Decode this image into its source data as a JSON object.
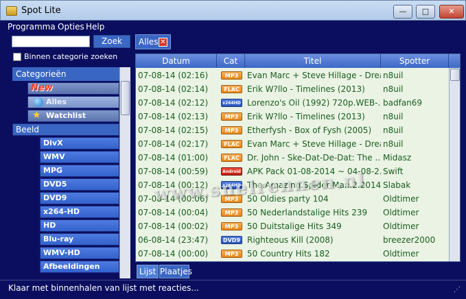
{
  "window": {
    "title": "Spot Lite",
    "min_glyph": "—",
    "max_glyph": "□",
    "close_glyph": "✕"
  },
  "menu": [
    "Programma",
    "Opties",
    "Help"
  ],
  "search": {
    "value": "",
    "button": "Zoek",
    "checkbox_label": "Binnen categorie zoeken",
    "checked": false
  },
  "categories": {
    "header": "Categorieën",
    "new": "New",
    "alles": "Alles",
    "watchlist": "Watchlist",
    "beeld": "Beeld",
    "sub": [
      "DivX",
      "WMV",
      "MPG",
      "DVD5",
      "DVD9",
      "x264-HD",
      "HD",
      "Blu-ray",
      "WMV-HD",
      "Afbeeldingen"
    ]
  },
  "tab": {
    "label": "Alles",
    "close": "✕"
  },
  "grid": {
    "columns": [
      "Datum",
      "Cat",
      "Titel",
      "Spotter"
    ],
    "rows": [
      {
        "date": "07-08-14 (02:16)",
        "cat": "MP3",
        "title": "Evan Marc + Steve Hillage - Drea...",
        "spotter": "n8uil"
      },
      {
        "date": "07-08-14 (02:14)",
        "cat": "FLAC",
        "title": "Erik W?llo - Timelines (2013)",
        "spotter": "n8uil"
      },
      {
        "date": "07-08-14 (02:12)",
        "cat": "x264HD",
        "title": "Lorenzo's Oil (1992) 720p.WEB-...",
        "spotter": "badfan69"
      },
      {
        "date": "07-08-14 (02:13)",
        "cat": "MP3",
        "title": "Erik W?llo - Timelines (2013)",
        "spotter": "n8uil"
      },
      {
        "date": "07-08-14 (02:15)",
        "cat": "MP3",
        "title": "Etherfysh - Box of Fysh (2005)",
        "spotter": "n8uil"
      },
      {
        "date": "07-08-14 (02:17)",
        "cat": "FLAC",
        "title": "Evan Marc + Steve Hillage - Drea...",
        "spotter": "n8uil"
      },
      {
        "date": "07-08-14 (01:00)",
        "cat": "FLAC",
        "title": "Dr. John - Ske-Dat-De-Dat: The ...",
        "spotter": "Midasz"
      },
      {
        "date": "07-08-14 (00:59)",
        "cat": "Android",
        "title": "APK Pack 01-08-2014 ~ 04-08-2...",
        "spotter": "Swift"
      },
      {
        "date": "07-08-14 (00:12)",
        "cat": "x264HD",
        "title": "The.Amazing.Spider-Man.2.2014....",
        "spotter": "Slabak"
      },
      {
        "date": "07-08-14 (00:06)",
        "cat": "MP3",
        "title": "50 Oldies party 104",
        "spotter": "Oldtimer"
      },
      {
        "date": "07-08-14 (00:04)",
        "cat": "MP3",
        "title": "50 Nederlandstalige Hits 239",
        "spotter": "Oldtimer"
      },
      {
        "date": "07-08-14 (00:02)",
        "cat": "MP3",
        "title": "50 Duitstalige Hits 349",
        "spotter": "Oldtimer"
      },
      {
        "date": "06-08-14 (23:47)",
        "cat": "DVD9",
        "title": "Righteous Kill (2008)",
        "spotter": "breezer2000"
      },
      {
        "date": "07-08-14 (00:00)",
        "cat": "MP3",
        "title": "50 Country Hits 182",
        "spotter": "Oldtimer"
      }
    ]
  },
  "watermark": "www.snelrennen.nl",
  "bottom_tabs": [
    "Lijst",
    "Plaatjes"
  ],
  "status": {
    "text": "Klaar met binnenhalen van lijst met reacties...",
    "grip": "⋰"
  }
}
